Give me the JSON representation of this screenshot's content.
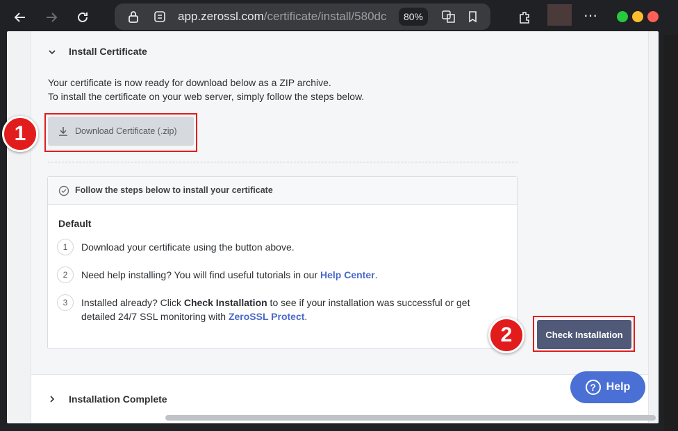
{
  "browser": {
    "url_host": "app.zerossl.com",
    "url_path": "/certificate/install/580dc",
    "zoom": "80%"
  },
  "install_section": {
    "title": "Install Certificate",
    "line1": "Your certificate is now ready for download below as a ZIP archive.",
    "line2": "To install the certificate on your web server, simply follow the steps below.",
    "download_label": "Download Certificate (.zip)"
  },
  "steps_box": {
    "heading": "Follow the steps below to install your certificate",
    "default_label": "Default",
    "steps": [
      {
        "num": "1",
        "text": "Download your certificate using the button above."
      },
      {
        "num": "2",
        "pre": "Need help installing? You will find useful tutorials in our ",
        "link": "Help Center",
        "post": "."
      },
      {
        "num": "3",
        "pre": "Installed already? Click ",
        "bold": "Check Installation",
        "mid": " to see if your installation was successful or get",
        "line2_pre": "detailed 24/7 SSL monitoring with ",
        "link": "ZeroSSL Protect",
        "post": "."
      }
    ]
  },
  "check_button": "Check Installation",
  "annotations": {
    "badge1": "1",
    "badge2": "2"
  },
  "complete_section": {
    "title": "Installation Complete"
  },
  "help_button": {
    "label": "Help",
    "icon": "?"
  },
  "colors": {
    "accent": "#4a70d6",
    "highlight": "#e21c1c",
    "check_btn": "#505a78"
  }
}
